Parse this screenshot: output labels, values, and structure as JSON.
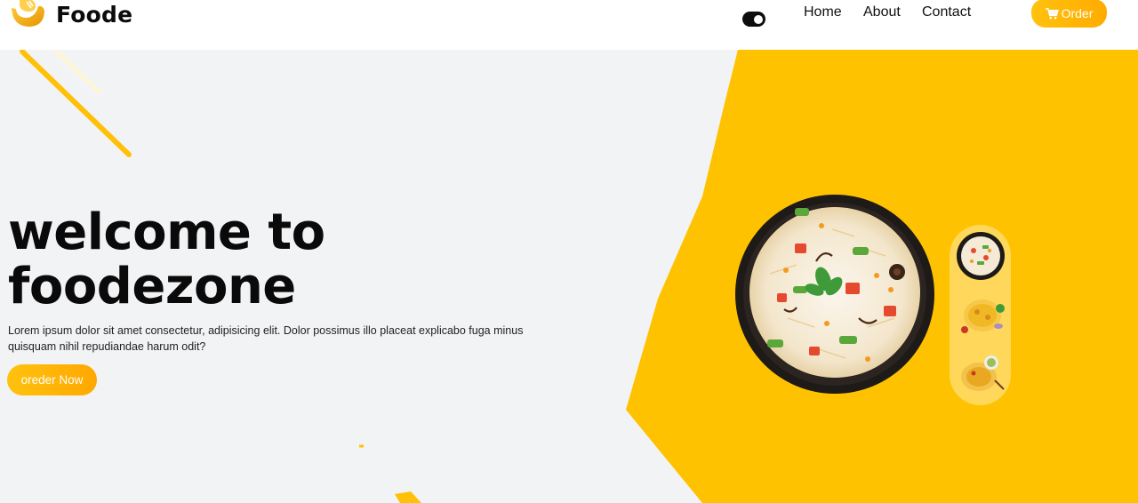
{
  "header": {
    "brand": "Foode",
    "nav": [
      {
        "label": "Home"
      },
      {
        "label": "About"
      },
      {
        "label": "Contact"
      }
    ],
    "order_button": "Order"
  },
  "hero": {
    "title_line1": "welcome to",
    "title_line2": "foodezone",
    "description": "Lorem ipsum dolor sit amet consectetur, adipisicing elit. Dolor possimus illo placeat explicabo fuga minus quisquam nihil repudiandae harum odit?",
    "cta": "oreder Now"
  },
  "colors": {
    "accent": "#ffc107",
    "hero_background": "#f2f3f5",
    "rail": "#ffd75a"
  },
  "icons": [
    "logo-icon",
    "theme-toggle-icon",
    "cart-icon"
  ]
}
